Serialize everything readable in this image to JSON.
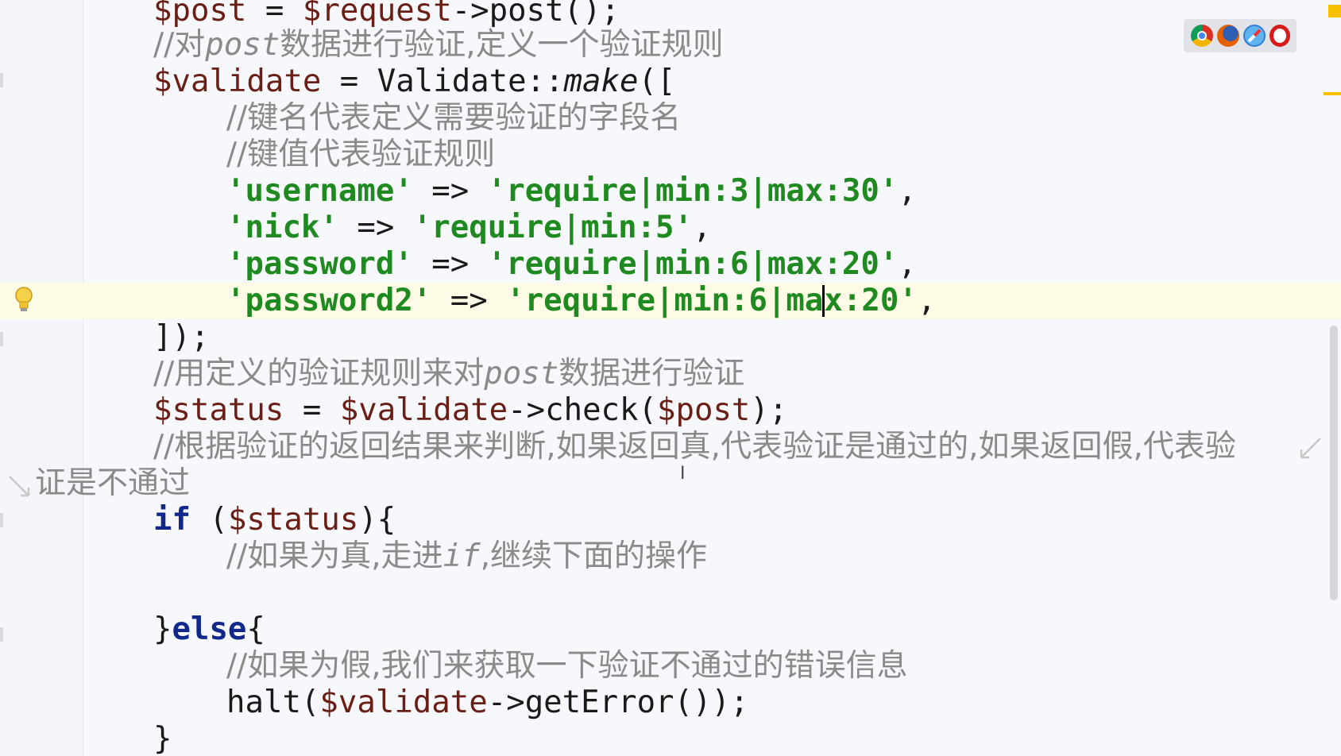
{
  "editor": {
    "lines": [
      {
        "segments": [
          {
            "t": "$post",
            "c": "var"
          },
          {
            "t": " = ",
            "c": "plain"
          },
          {
            "t": "$request",
            "c": "var"
          },
          {
            "t": "->post();",
            "c": "plain"
          }
        ]
      },
      {
        "segments": [
          {
            "t": "//对",
            "c": "cmt"
          },
          {
            "t": "post",
            "c": "cmtm"
          },
          {
            "t": "数据进行验证,定义一个验证规则",
            "c": "cmt"
          }
        ]
      },
      {
        "segments": [
          {
            "t": "$validate",
            "c": "var"
          },
          {
            "t": " = Validate::",
            "c": "plain"
          },
          {
            "t": "make",
            "c": "it"
          },
          {
            "t": "([",
            "c": "plain"
          }
        ]
      },
      {
        "segments": [
          {
            "t": "//键名代表定义需要验证的字段名",
            "c": "cmt"
          }
        ]
      },
      {
        "segments": [
          {
            "t": "//键值代表验证规则",
            "c": "cmt"
          }
        ]
      },
      {
        "segments": [
          {
            "t": "'username'",
            "c": "str"
          },
          {
            "t": " => ",
            "c": "plain"
          },
          {
            "t": "'require|min:3|max:30'",
            "c": "str"
          },
          {
            "t": ",",
            "c": "plain"
          }
        ]
      },
      {
        "segments": [
          {
            "t": "'nick'",
            "c": "str"
          },
          {
            "t": " => ",
            "c": "plain"
          },
          {
            "t": "'require|min:5'",
            "c": "str"
          },
          {
            "t": ",",
            "c": "plain"
          }
        ]
      },
      {
        "segments": [
          {
            "t": "'password'",
            "c": "str"
          },
          {
            "t": " => ",
            "c": "plain"
          },
          {
            "t": "'require|min:6|max:20'",
            "c": "str"
          },
          {
            "t": ",",
            "c": "plain"
          }
        ]
      },
      {
        "segments": [
          {
            "t": "'password2'",
            "c": "str"
          },
          {
            "t": " => ",
            "c": "plain"
          },
          {
            "t": "'require|min:6|ma",
            "c": "str"
          },
          {
            "t": "",
            "c": "caret"
          },
          {
            "t": "x:20'",
            "c": "str"
          },
          {
            "t": ",",
            "c": "plain"
          }
        ]
      },
      {
        "segments": [
          {
            "t": "]);",
            "c": "plain"
          }
        ]
      },
      {
        "segments": [
          {
            "t": "//用定义的验证规则来对",
            "c": "cmt"
          },
          {
            "t": "post",
            "c": "cmtm"
          },
          {
            "t": "数据进行验证",
            "c": "cmt"
          }
        ]
      },
      {
        "segments": [
          {
            "t": "$status",
            "c": "var"
          },
          {
            "t": " = ",
            "c": "plain"
          },
          {
            "t": "$validate",
            "c": "var"
          },
          {
            "t": "->check(",
            "c": "plain"
          },
          {
            "t": "$post",
            "c": "var"
          },
          {
            "t": ");",
            "c": "plain"
          }
        ]
      },
      {
        "segments": [
          {
            "t": "//根据验证的返回结果来判断,如果返回真,代表验证是通过的,如果返回假,代表验",
            "c": "cmt"
          }
        ]
      },
      {
        "segments": [
          {
            "t": "证是不通过",
            "c": "cmt"
          }
        ]
      },
      {
        "segments": [
          {
            "t": "if",
            "c": "kw"
          },
          {
            "t": " (",
            "c": "plain"
          },
          {
            "t": "$status",
            "c": "var"
          },
          {
            "t": "){",
            "c": "plain"
          }
        ]
      },
      {
        "segments": [
          {
            "t": "//如果为真,走进",
            "c": "cmt"
          },
          {
            "t": "if",
            "c": "cmtm"
          },
          {
            "t": ",继续下面的操作",
            "c": "cmt"
          }
        ]
      },
      {
        "segments": []
      },
      {
        "segments": [
          {
            "t": "}",
            "c": "plain"
          },
          {
            "t": "else",
            "c": "kw"
          },
          {
            "t": "{",
            "c": "plain"
          }
        ]
      },
      {
        "segments": [
          {
            "t": "//如果为假,我们来获取一下验证不通过的错误信息",
            "c": "cmt"
          }
        ]
      },
      {
        "segments": [
          {
            "t": "halt(",
            "c": "plain"
          },
          {
            "t": "$validate",
            "c": "var"
          },
          {
            "t": "->getError());",
            "c": "plain"
          }
        ]
      },
      {
        "segments": [
          {
            "t": "}",
            "c": "plain"
          }
        ]
      }
    ]
  },
  "icons": {
    "bulb": "lightbulb-icon",
    "browsers": [
      "chrome-icon",
      "firefox-icon",
      "safari-icon",
      "opera-icon"
    ],
    "wrap": [
      "soft-wrap-icon",
      "soft-wrap-continue-icon"
    ]
  },
  "colors": {
    "variable": "#6a1f16",
    "comment": "#8a8a8a",
    "string": "#1f8a1f",
    "keyword": "#10288c",
    "current_line": "#fdfbe6",
    "background": "#f7f8fb"
  }
}
